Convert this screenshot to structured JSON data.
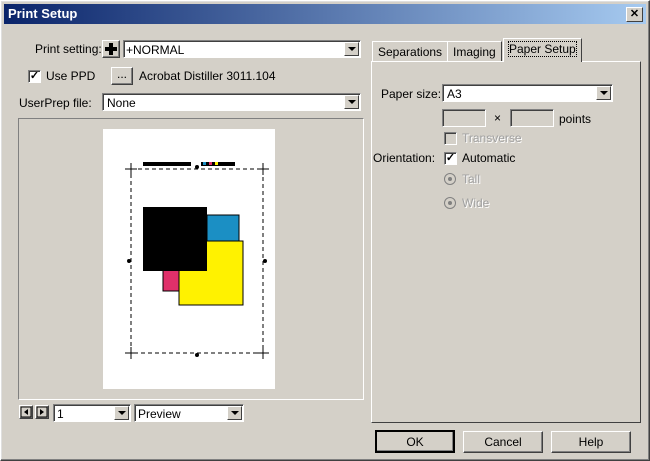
{
  "window": {
    "title": "Print Setup",
    "close_glyph": "✕"
  },
  "left": {
    "print_setting_label": "Print setting:",
    "print_setting_value": "+NORMAL",
    "use_ppd_label": "Use PPD",
    "use_ppd_checked": true,
    "ppd_browse_label": "...",
    "ppd_name": "Acrobat Distiller 3011.104",
    "userprep_label": "UserPrep file:",
    "userprep_value": "None",
    "page_select_value": "1",
    "view_select_value": "Preview"
  },
  "tabs": [
    {
      "label": "Separations",
      "active": false
    },
    {
      "label": "Imaging",
      "active": false
    },
    {
      "label": "Paper Setup",
      "active": true
    }
  ],
  "paper_setup": {
    "paper_size_label": "Paper size:",
    "paper_size_value": "A3",
    "width_value": "",
    "times_glyph": "×",
    "height_value": "",
    "units_label": "points",
    "transverse_label": "Transverse",
    "orientation_label": "Orientation:",
    "automatic_label": "Automatic",
    "automatic_checked": true,
    "tall_label": "Tall",
    "wide_label": "Wide"
  },
  "buttons": {
    "ok": "OK",
    "cancel": "Cancel",
    "help": "Help"
  },
  "colors": {
    "cyan": "#1b8fc4",
    "magenta": "#e0306a",
    "yellow": "#fff200",
    "black": "#000000",
    "title_start": "#0a246a"
  }
}
